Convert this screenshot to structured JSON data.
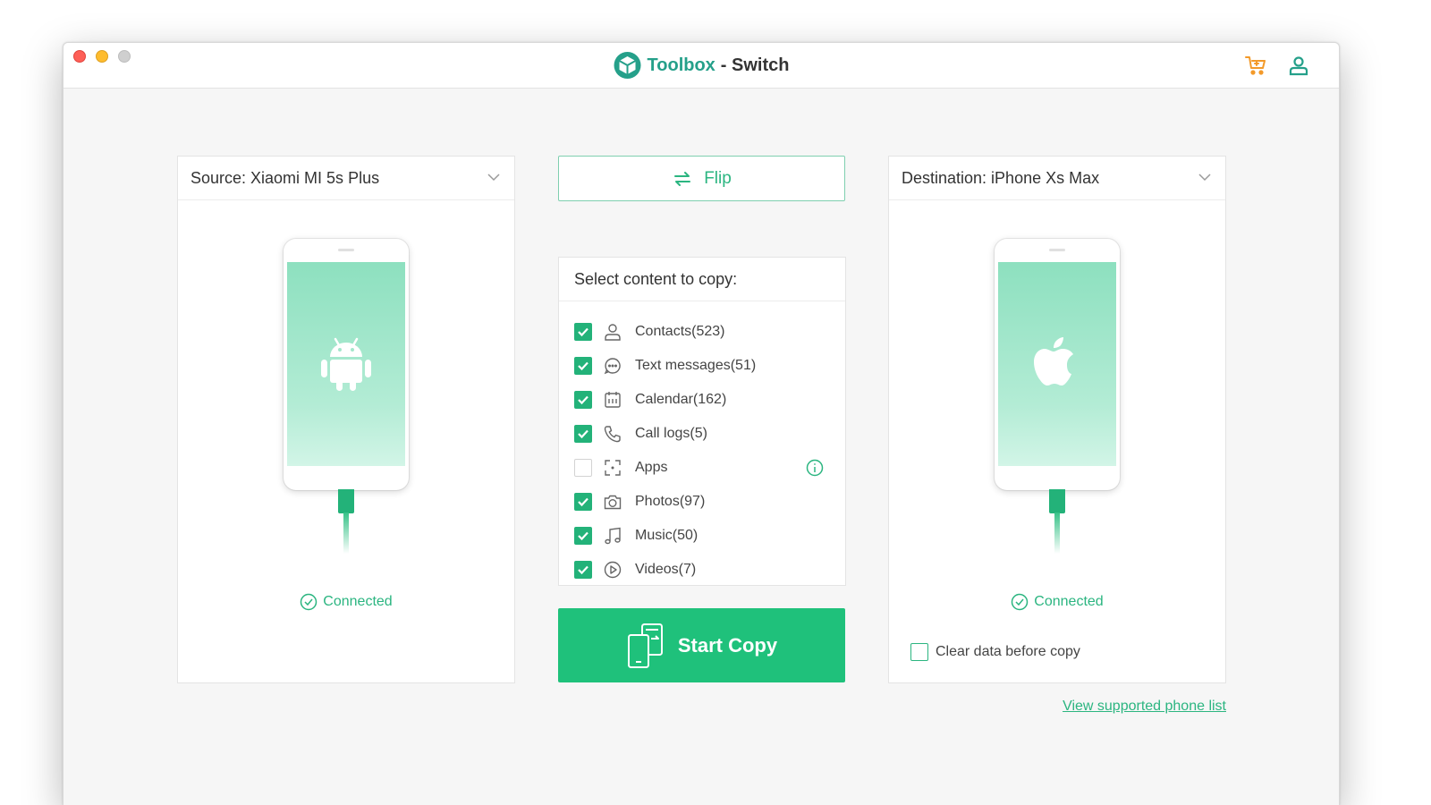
{
  "window": {
    "brand": "Toolbox",
    "subtitle": "- Switch",
    "icons": [
      "logo-icon",
      "cart-icon",
      "user-icon"
    ]
  },
  "source": {
    "label": "Source: Xiaomi MI 5s Plus",
    "os_icon": "android-icon",
    "status": "Connected"
  },
  "destination": {
    "label": "Destination: iPhone Xs Max",
    "os_icon": "apple-icon",
    "status": "Connected",
    "clear_label": "Clear data before copy",
    "clear_checked": false
  },
  "flip": {
    "label": "Flip"
  },
  "content": {
    "title": "Select content to copy:",
    "items": [
      {
        "label": "Contacts(523)",
        "checked": true,
        "icon": "contacts-icon"
      },
      {
        "label": "Text messages(51)",
        "checked": true,
        "icon": "message-icon"
      },
      {
        "label": "Calendar(162)",
        "checked": true,
        "icon": "calendar-icon"
      },
      {
        "label": "Call logs(5)",
        "checked": true,
        "icon": "phone-icon"
      },
      {
        "label": "Apps",
        "checked": false,
        "icon": "apps-icon"
      },
      {
        "label": "Photos(97)",
        "checked": true,
        "icon": "camera-icon"
      },
      {
        "label": "Music(50)",
        "checked": true,
        "icon": "music-icon"
      },
      {
        "label": "Videos(7)",
        "checked": true,
        "icon": "video-icon"
      }
    ]
  },
  "start": {
    "label": "Start Copy"
  },
  "footer": {
    "link": "View supported phone list"
  },
  "colors": {
    "accent": "#1fc17b",
    "brand": "#25a08a",
    "cart": "#f39a2a"
  }
}
